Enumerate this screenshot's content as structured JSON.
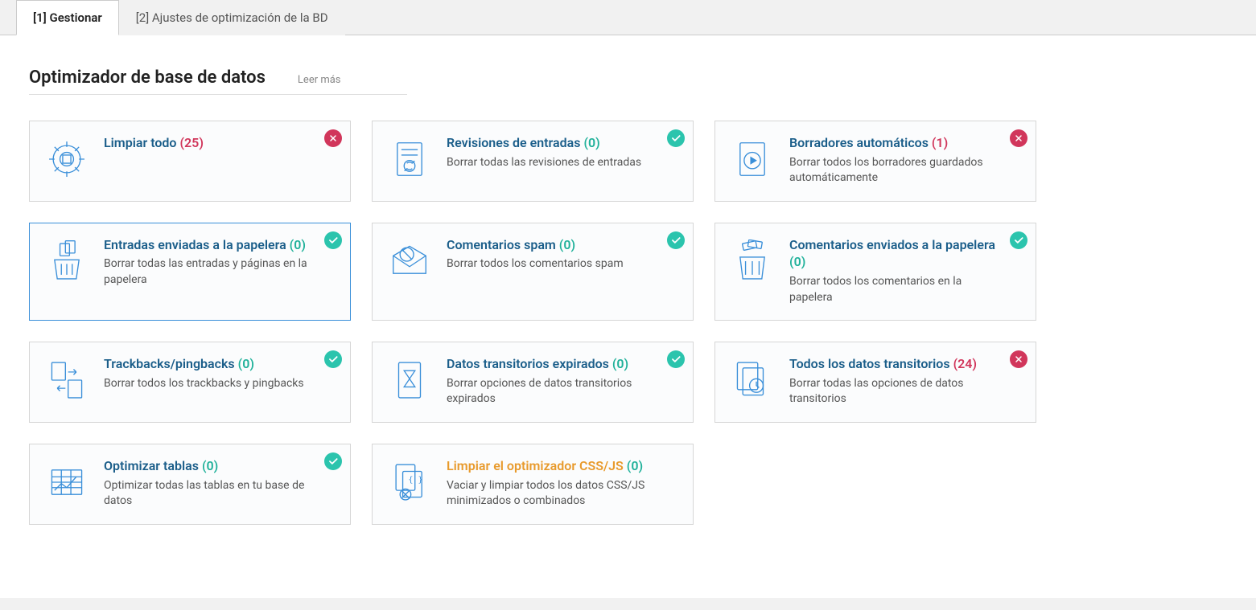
{
  "tabs": [
    {
      "label": "[1] Gestionar",
      "active": true
    },
    {
      "label": "[2] Ajustes de optimización de la BD",
      "active": false
    }
  ],
  "page_title": "Optimizador de base de datos",
  "read_more": "Leer más",
  "cards": [
    {
      "title": "Limpiar todo",
      "count": 25,
      "desc": "",
      "status": "bad",
      "icon": "gear-cube",
      "selected": false,
      "orange": false
    },
    {
      "title": "Revisiones de entradas",
      "count": 0,
      "desc": "Borrar todas las revisiones de entradas",
      "status": "ok",
      "icon": "doc-refresh",
      "selected": false,
      "orange": false
    },
    {
      "title": "Borradores automáticos",
      "count": 1,
      "desc": "Borrar todos los borradores guardados automáticamente",
      "status": "bad",
      "icon": "doc-play",
      "selected": false,
      "orange": false
    },
    {
      "title": "Entradas enviadas a la papelera",
      "count": 0,
      "desc": "Borrar todas las entradas y páginas en la papelera",
      "status": "ok",
      "icon": "trash-files",
      "selected": true,
      "orange": false
    },
    {
      "title": "Comentarios spam",
      "count": 0,
      "desc": "Borrar todos los comentarios spam",
      "status": "ok",
      "icon": "envelope-spam",
      "selected": false,
      "orange": false
    },
    {
      "title": "Comentarios enviados a la papelera",
      "count": 0,
      "desc": "Borrar todos los comentarios en la papelera",
      "status": "ok",
      "icon": "trash-comments",
      "selected": false,
      "orange": false
    },
    {
      "title": "Trackbacks/pingbacks",
      "count": 0,
      "desc": "Borrar todos los trackbacks y pingbacks",
      "status": "ok",
      "icon": "pages-swap",
      "selected": false,
      "orange": false
    },
    {
      "title": "Datos transitorios expirados",
      "count": 0,
      "desc": "Borrar opciones de datos transitorios expirados",
      "status": "ok",
      "icon": "doc-hourglass",
      "selected": false,
      "orange": false
    },
    {
      "title": "Todos los datos transitorios",
      "count": 24,
      "desc": "Borrar todas las opciones de datos transitorios",
      "status": "bad",
      "icon": "docs-clock",
      "selected": false,
      "orange": false
    },
    {
      "title": "Optimizar tablas",
      "count": 0,
      "desc": "Optimizar todas las tablas en tu base de datos",
      "status": "ok",
      "icon": "table-chart",
      "selected": false,
      "orange": false
    },
    {
      "title": "Limpiar el optimizador CSS/JS",
      "count": 0,
      "desc": "Vaciar y limpiar todos los datos CSS/JS minimizados o combinados",
      "status": "none",
      "icon": "docs-code",
      "selected": false,
      "orange": true
    }
  ]
}
